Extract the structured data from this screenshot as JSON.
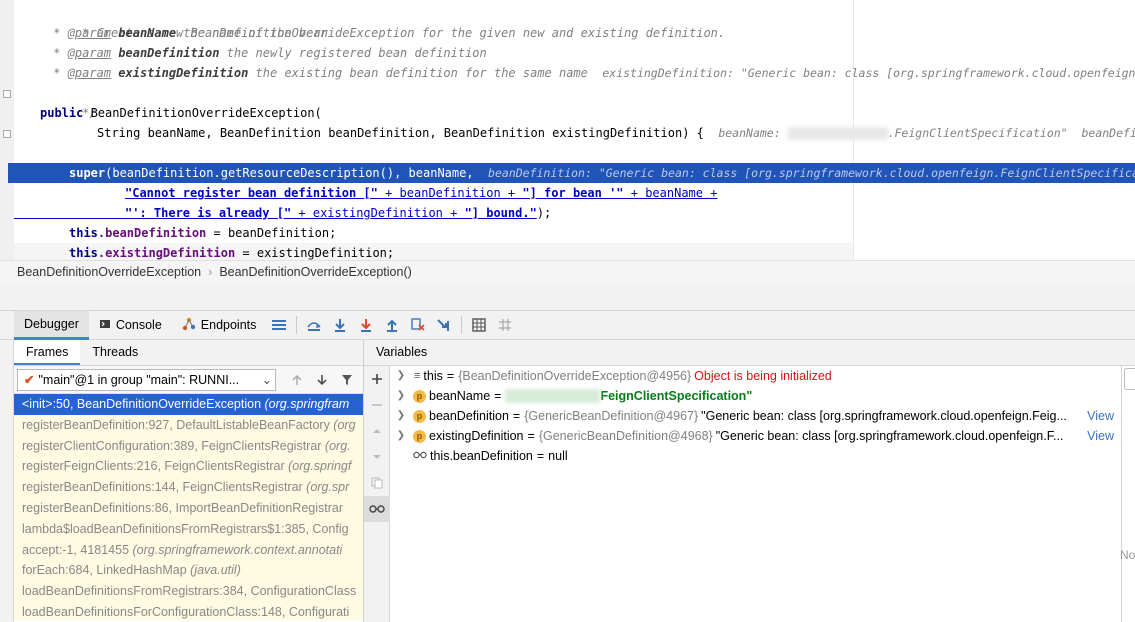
{
  "editor": {
    "lines": [
      {
        "kind": "comment",
        "text": " * Create a new BeanDefinitionOverrideException for the given new and existing definition."
      },
      {
        "kind": "param",
        "tag": "@param",
        "name": "beanName",
        "desc": " the name of the bean"
      },
      {
        "kind": "param",
        "tag": "@param",
        "name": "beanDefinition",
        "desc": " the newly registered bean definition"
      },
      {
        "kind": "param",
        "tag": "@param",
        "name": "existingDefinition",
        "desc": " the existing bean definition for the same name",
        "hint": "existingDefinition: \"Generic bean: class [org.springframework.cloud.openfeign.Fe"
      },
      {
        "kind": "comment",
        "text": " */"
      }
    ],
    "ctor_kw": "public",
    "ctor_sig": " BeanDefinitionOverrideException(",
    "params_line": "String beanName, BeanDefinition beanDefinition, BeanDefinition existingDefinition) {",
    "params_hint_a": "beanName: ",
    "params_hint_b": ".FeignClientSpecification\"",
    "params_hint_c": "beanDefinit",
    "super_kw": "super",
    "super_rest": "(beanDefinition.getResourceDescription(), beanName,",
    "super_hint": "beanDefinition: \"Generic bean: class [org.springframework.cloud.openfeign.FeignClientSpecificat",
    "str1": "\"Cannot register bean definition [\"",
    "str1_rest": " + beanDefinition + ",
    "str2": "\"] for bean '\"",
    "str2_rest": " + beanName +",
    "str3": "\"': There is already [\"",
    "str3_rest": " + existingDefinition + ",
    "str4": "\"] bound.\"",
    "str4_end": ");",
    "assign1_kw": "this",
    "assign1_field": ".beanDefinition",
    "assign1_rest": " = beanDefinition;",
    "assign2_kw": "this",
    "assign2_field": ".existingDefinition",
    "assign2_rest": " = existingDefinition;"
  },
  "breadcrumb": {
    "items": [
      "BeanDefinitionOverrideException",
      "BeanDefinitionOverrideException()"
    ],
    "separator": "›"
  },
  "debug_toolbar": {
    "tabs": [
      {
        "label": "Debugger",
        "active": true
      },
      {
        "label": "Console",
        "active": false
      },
      {
        "label": "Endpoints",
        "active": false
      }
    ]
  },
  "frames_panel": {
    "tabs": [
      {
        "label": "Frames",
        "active": true
      },
      {
        "label": "Threads",
        "active": false
      }
    ],
    "thread": "\"main\"@1 in group \"main\": RUNNI...",
    "frames": [
      {
        "method": "<init>:50, BeanDefinitionOverrideException",
        "pkg": " (org.springfram",
        "selected": true
      },
      {
        "method": "registerBeanDefinition:927, DefaultListableBeanFactory",
        "pkg": " (org",
        "selected": false
      },
      {
        "method": "registerClientConfiguration:389, FeignClientsRegistrar",
        "pkg": " (org.",
        "selected": false
      },
      {
        "method": "registerFeignClients:216, FeignClientsRegistrar",
        "pkg": " (org.springf",
        "selected": false
      },
      {
        "method": "registerBeanDefinitions:144, FeignClientsRegistrar",
        "pkg": " (org.spr",
        "selected": false
      },
      {
        "method": "registerBeanDefinitions:86, ImportBeanDefinitionRegistrar",
        "pkg": "",
        "selected": false
      },
      {
        "method": "lambda$loadBeanDefinitionsFromRegistrars$1:385, Config",
        "pkg": "",
        "selected": false
      },
      {
        "method": "accept:-1, 4181455",
        "pkg": " (org.springframework.context.annotati",
        "selected": false
      },
      {
        "method": "forEach:684, LinkedHashMap",
        "pkg": " (java.util)",
        "selected": false
      },
      {
        "method": "loadBeanDefinitionsFromRegistrars:384, ConfigurationClass",
        "pkg": "",
        "selected": false
      },
      {
        "method": "loadBeanDefinitionsForConfigurationClass:148, Configurati",
        "pkg": "",
        "selected": false
      }
    ]
  },
  "variables_panel": {
    "title": "Variables",
    "vars": [
      {
        "name": "this",
        "ref": "{BeanDefinitionOverrideException@4956}",
        "extra": "Object is being initialized"
      },
      {
        "name": "beanName",
        "value_suffix": "FeignClientSpecification\""
      },
      {
        "name": "beanDefinition",
        "ref": "{GenericBeanDefinition@4967}",
        "value": "\"Generic bean: class [org.springframework.cloud.openfeign.Feig...",
        "view": "View"
      },
      {
        "name": "existingDefinition",
        "ref": "{GenericBeanDefinition@4968}",
        "value": "\"Generic bean: class [org.springframework.cloud.openfeign.F...",
        "view": "View"
      },
      {
        "name": "this.beanDefinition",
        "value": "null"
      }
    ],
    "right_edge_text": "No"
  },
  "colors": {
    "selection": "#2154b9",
    "frame_selected": "#2563d5",
    "frame_bg": "#fffbe3",
    "error_text": "#dd1111"
  }
}
